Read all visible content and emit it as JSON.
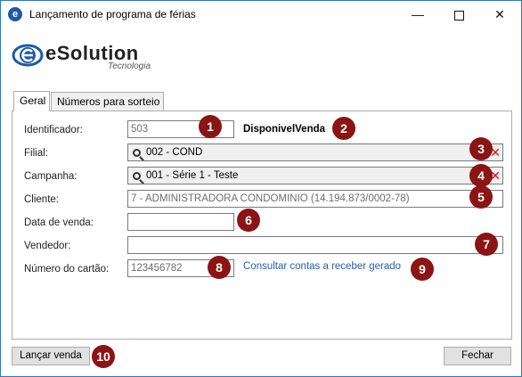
{
  "window": {
    "title": "Lançamento de programa de férias",
    "minimize_glyph": "—",
    "close_glyph": "✕"
  },
  "logo": {
    "name": "eSolution",
    "subtitle": "Tecnologia"
  },
  "tabs": [
    {
      "label": "Geral",
      "active": true
    },
    {
      "label": "Números para sorteio",
      "active": false
    }
  ],
  "form": {
    "identificador": {
      "label": "Identificador:",
      "value": "503"
    },
    "status": "DisponivelVenda",
    "filial": {
      "label": "Filial:",
      "value": "002 - COND"
    },
    "campanha": {
      "label": "Campanha:",
      "value": "001 - Série 1 - Teste"
    },
    "cliente": {
      "label": "Cliente:",
      "value": "7 - ADMINISTRADORA CONDOMINIO (14.194.873/0002-78)"
    },
    "data_venda": {
      "label": "Data de venda:",
      "value": ""
    },
    "vendedor": {
      "label": "Vendedor:",
      "value": ""
    },
    "numero_cartao": {
      "label": "Número do cartão:",
      "value": "123456782"
    },
    "consultar_link": "Consultar contas a receber gerado"
  },
  "badges": [
    "1",
    "2",
    "3",
    "4",
    "5",
    "6",
    "7",
    "8",
    "9",
    "10"
  ],
  "buttons": {
    "lancar": "Lançar venda",
    "fechar": "Fechar"
  },
  "colors": {
    "badge": "#8b1414",
    "link": "#2a5db0",
    "clear": "#dd1111",
    "window_border": "#2b79c2"
  }
}
